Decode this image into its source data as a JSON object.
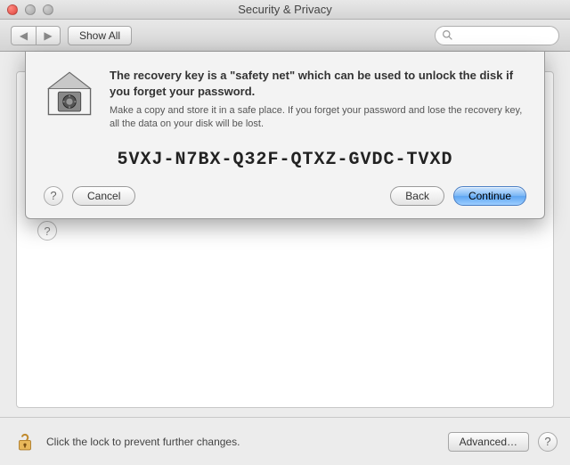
{
  "window": {
    "title": "Security & Privacy"
  },
  "toolbar": {
    "show_all": "Show All",
    "search_placeholder": ""
  },
  "sheet": {
    "heading": "The recovery key is a \"safety net\" which can be used to unlock the disk if you forget your password.",
    "subtext": "Make a copy and store it in a safe place. If you forget your password and lose the recovery key, all the data on your disk will be lost.",
    "recovery_key": "5VXJ-N7BX-Q32F-QTXZ-GVDC-TVXD",
    "help_label": "?",
    "cancel": "Cancel",
    "back": "Back",
    "continue": "Continue"
  },
  "bottom": {
    "lock_text": "Click the lock to prevent further changes.",
    "advanced": "Advanced…",
    "help": "?"
  },
  "icons": {
    "back_glyph": "◀",
    "forward_glyph": "▶"
  }
}
